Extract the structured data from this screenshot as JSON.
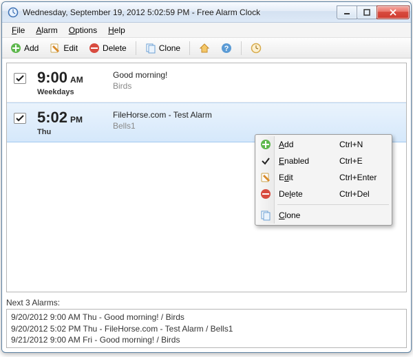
{
  "window": {
    "title": "Wednesday, September 19, 2012 5:02:59 PM - Free Alarm Clock"
  },
  "menubar": {
    "file": "File",
    "alarm": "Alarm",
    "options": "Options",
    "help": "Help"
  },
  "toolbar": {
    "add": "Add",
    "edit": "Edit",
    "delete": "Delete",
    "clone": "Clone"
  },
  "alarms": [
    {
      "time": "9:00",
      "ampm": "AM",
      "days": "Weekdays",
      "title": "Good morning!",
      "sound": "Birds",
      "checked": true,
      "selected": false
    },
    {
      "time": "5:02",
      "ampm": "PM",
      "days": "Thu",
      "title": "FileHorse.com - Test Alarm",
      "sound": "Bells1",
      "checked": true,
      "selected": true
    }
  ],
  "context_menu": {
    "add": {
      "label": "Add",
      "shortcut": "Ctrl+N"
    },
    "enabled": {
      "label": "Enabled",
      "shortcut": "Ctrl+E"
    },
    "edit": {
      "label": "Edit",
      "shortcut": "Ctrl+Enter"
    },
    "delete": {
      "label": "Delete",
      "shortcut": "Ctrl+Del"
    },
    "clone": {
      "label": "Clone",
      "shortcut": ""
    }
  },
  "next": {
    "label": "Next 3 Alarms:",
    "lines": [
      "9/20/2012 9:00 AM Thu - Good morning! / Birds",
      "9/20/2012 5:02 PM Thu - FileHorse.com - Test Alarm / Bells1",
      "9/21/2012 9:00 AM Fri - Good morning! / Birds"
    ]
  }
}
